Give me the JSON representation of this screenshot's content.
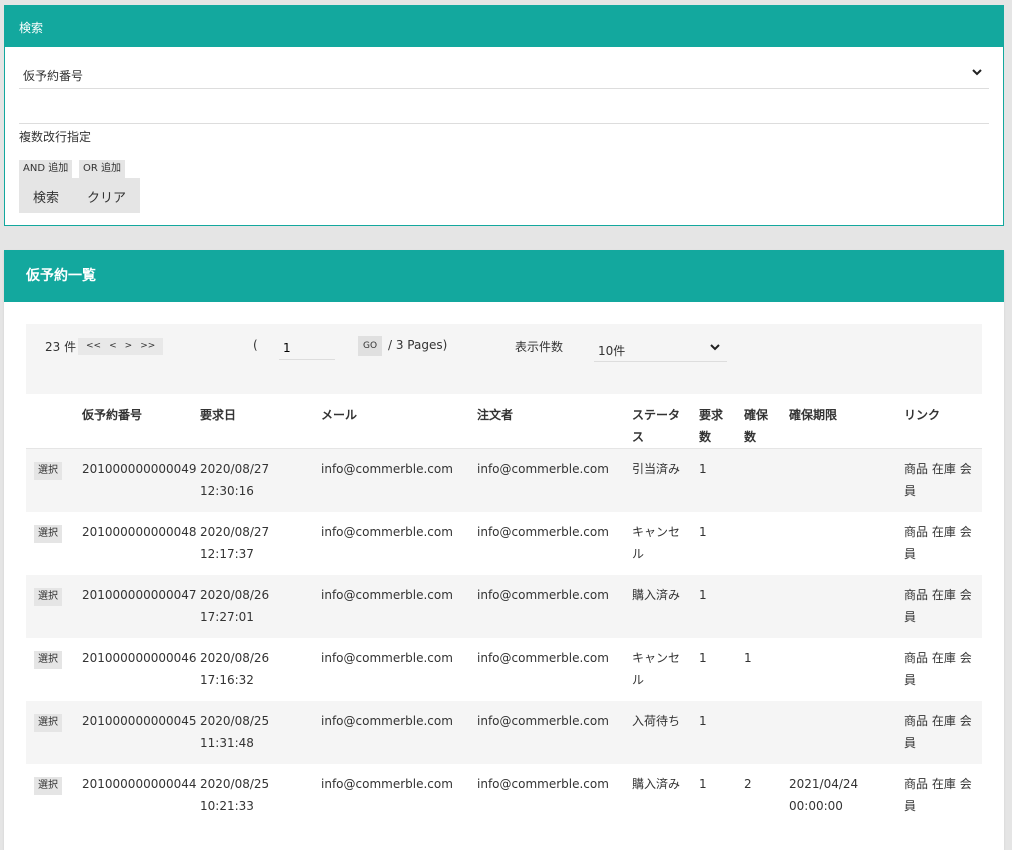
{
  "search": {
    "title": "検索",
    "field_select": "仮予約番号",
    "text_value": "",
    "multi_label": "複数改行指定",
    "and_add": "AND 追加",
    "or_add": "OR 追加",
    "search_button": "検索",
    "clear_button": "クリア"
  },
  "list": {
    "title": "仮予約一覧",
    "pager": {
      "count": "23 件",
      "first": "<<",
      "prev": "<",
      "next": ">",
      "last": ">>",
      "open_paren": "(",
      "current_page": "1",
      "go": "GO",
      "pages": "/ 3 Pages)",
      "display_label": "表示件数",
      "display_value": "10件"
    },
    "headers": [
      "",
      "仮予約番号",
      "要求日",
      "メール",
      "注文者",
      "ステータス",
      "要求数",
      "確保数",
      "確保期限",
      "リンク"
    ],
    "select_label": "選択",
    "links": {
      "product": "商品",
      "stock": "在庫",
      "member": "会員"
    },
    "rows": [
      {
        "id": "201000000000049",
        "date": "2020/08/27",
        "time": "12:30:16",
        "email": "info@commerble.com",
        "orderer": "info@commerble.com",
        "status": "引当済み",
        "req": "1",
        "secured": "",
        "limit_date": "",
        "limit_time": ""
      },
      {
        "id": "201000000000048",
        "date": "2020/08/27",
        "time": "12:17:37",
        "email": "info@commerble.com",
        "orderer": "info@commerble.com",
        "status": "キャンセル",
        "req": "1",
        "secured": "",
        "limit_date": "",
        "limit_time": ""
      },
      {
        "id": "201000000000047",
        "date": "2020/08/26",
        "time": "17:27:01",
        "email": "info@commerble.com",
        "orderer": "info@commerble.com",
        "status": "購入済み",
        "req": "1",
        "secured": "",
        "limit_date": "",
        "limit_time": ""
      },
      {
        "id": "201000000000046",
        "date": "2020/08/26",
        "time": "17:16:32",
        "email": "info@commerble.com",
        "orderer": "info@commerble.com",
        "status": "キャンセル",
        "req": "1",
        "secured": "1",
        "limit_date": "",
        "limit_time": ""
      },
      {
        "id": "201000000000045",
        "date": "2020/08/25",
        "time": "11:31:48",
        "email": "info@commerble.com",
        "orderer": "info@commerble.com",
        "status": "入荷待ち",
        "req": "1",
        "secured": "",
        "limit_date": "",
        "limit_time": ""
      },
      {
        "id": "201000000000044",
        "date": "2020/08/25",
        "time": "10:21:33",
        "email": "info@commerble.com",
        "orderer": "info@commerble.com",
        "status": "購入済み",
        "req": "1",
        "secured": "2",
        "limit_date": "2021/04/24",
        "limit_time": "00:00:00"
      }
    ]
  },
  "colors": {
    "accent": "#13a89e",
    "background": "#e5e5e5",
    "stripe": "#f5f5f5"
  },
  "icons": {
    "dropdown": "chevron-down-icon"
  }
}
